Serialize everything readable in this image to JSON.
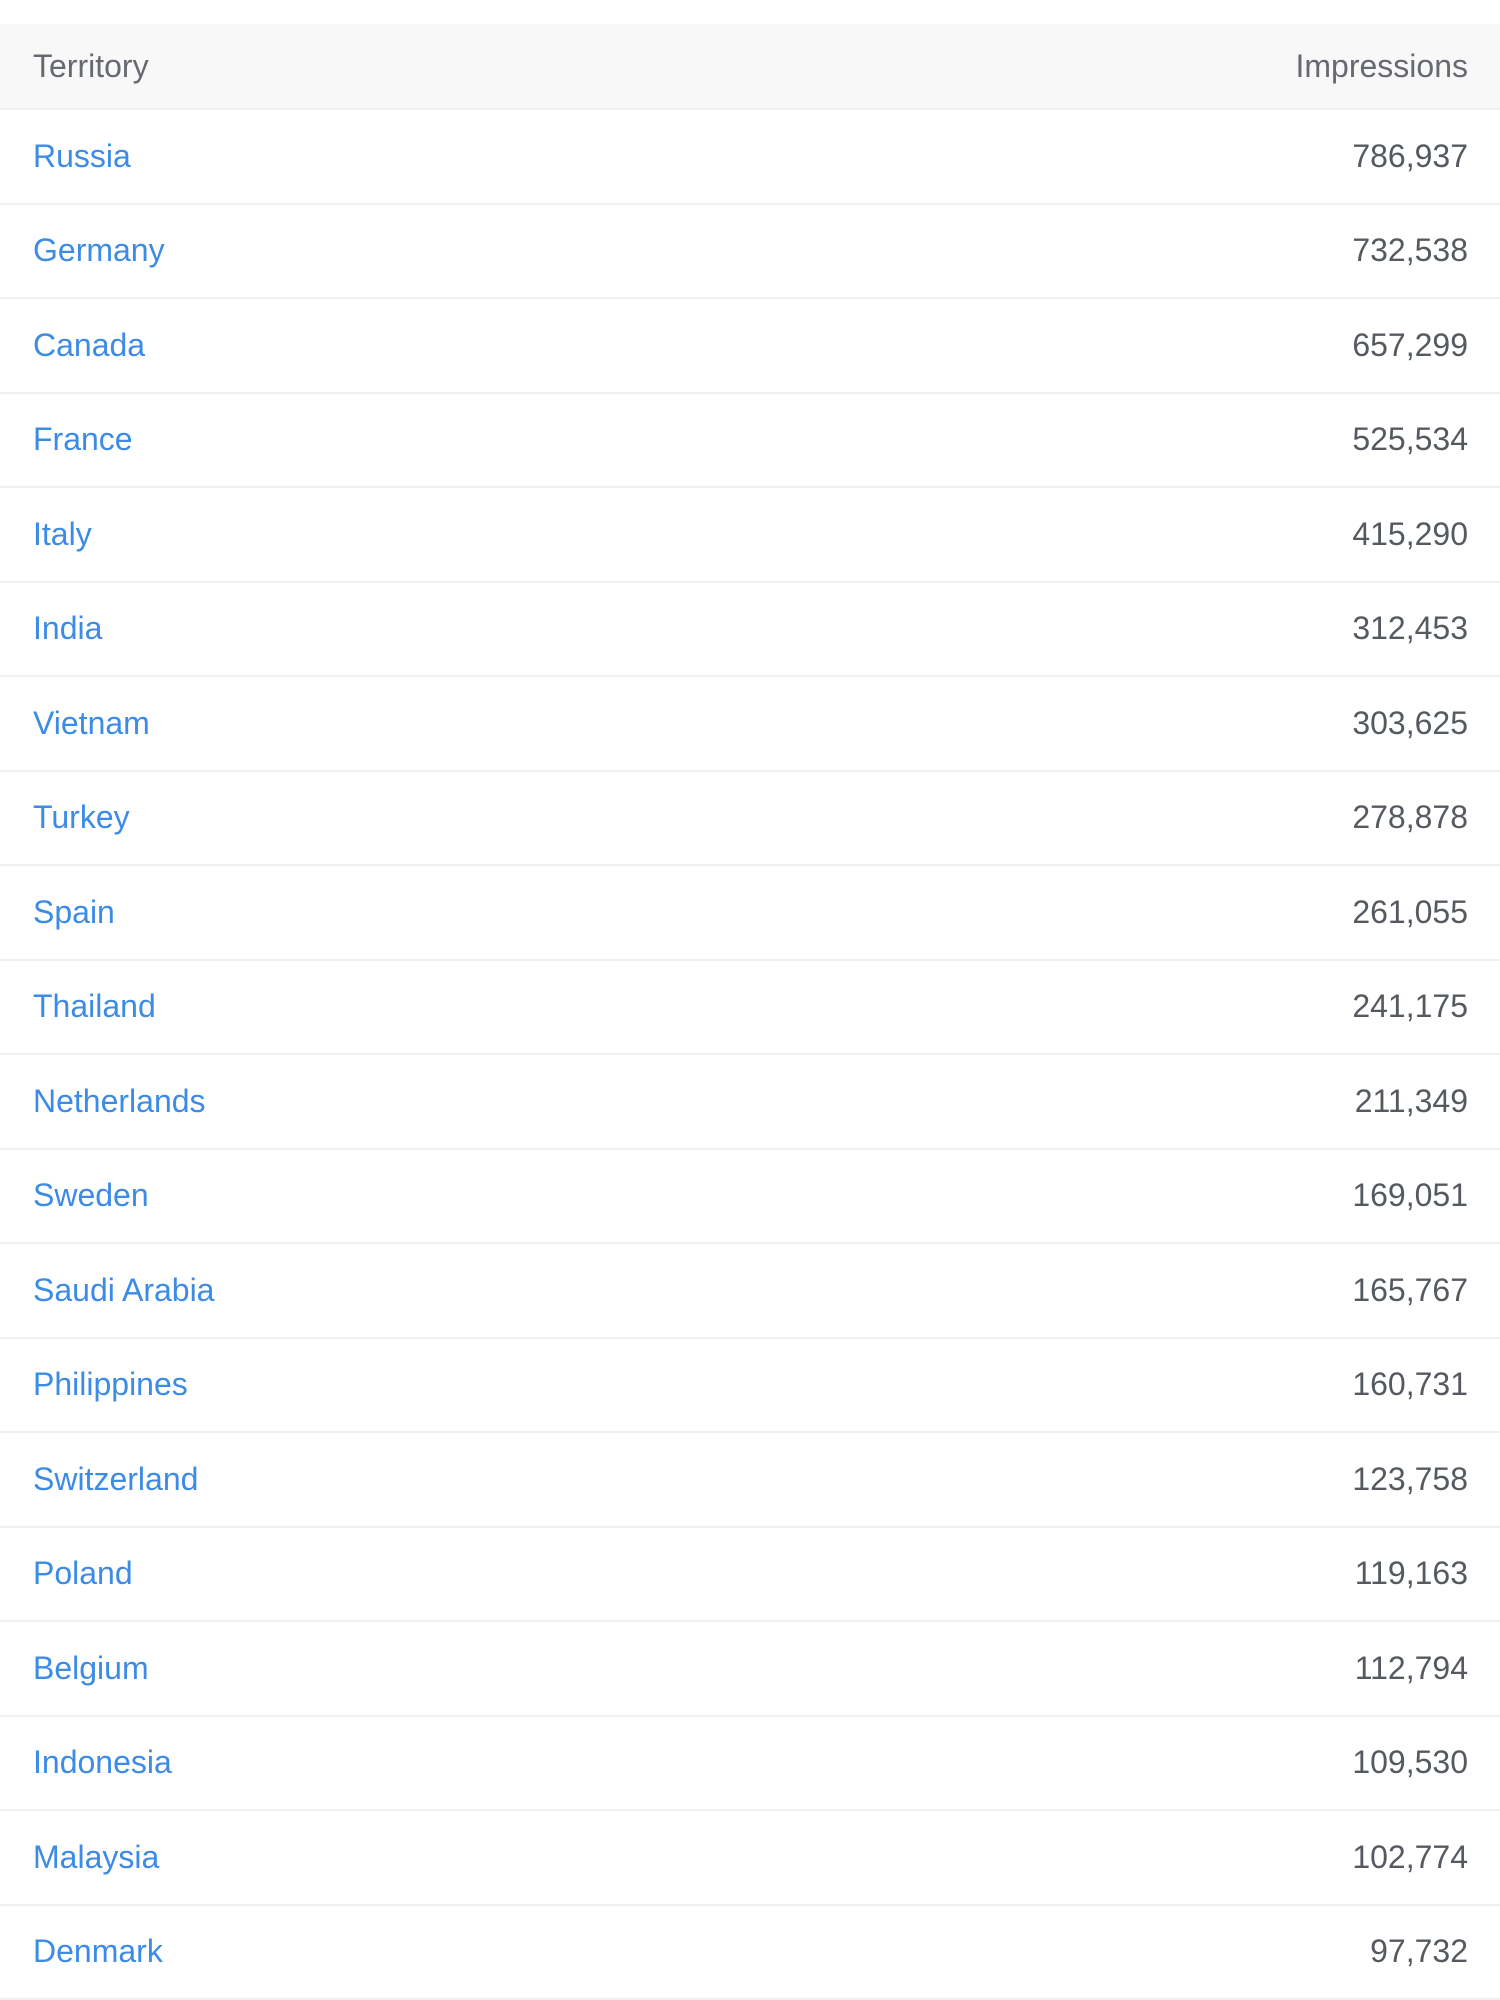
{
  "table": {
    "columns": [
      "Territory",
      "Impressions"
    ],
    "rows": [
      {
        "territory": "Russia",
        "impressions": "786,937"
      },
      {
        "territory": "Germany",
        "impressions": "732,538"
      },
      {
        "territory": "Canada",
        "impressions": "657,299"
      },
      {
        "territory": "France",
        "impressions": "525,534"
      },
      {
        "territory": "Italy",
        "impressions": "415,290"
      },
      {
        "territory": "India",
        "impressions": "312,453"
      },
      {
        "territory": "Vietnam",
        "impressions": "303,625"
      },
      {
        "territory": "Turkey",
        "impressions": "278,878"
      },
      {
        "territory": "Spain",
        "impressions": "261,055"
      },
      {
        "territory": "Thailand",
        "impressions": "241,175"
      },
      {
        "territory": "Netherlands",
        "impressions": "211,349"
      },
      {
        "territory": "Sweden",
        "impressions": "169,051"
      },
      {
        "territory": "Saudi Arabia",
        "impressions": "165,767"
      },
      {
        "territory": "Philippines",
        "impressions": "160,731"
      },
      {
        "territory": "Switzerland",
        "impressions": "123,758"
      },
      {
        "territory": "Poland",
        "impressions": "119,163"
      },
      {
        "territory": "Belgium",
        "impressions": "112,794"
      },
      {
        "territory": "Indonesia",
        "impressions": "109,530"
      },
      {
        "territory": "Malaysia",
        "impressions": "102,774"
      },
      {
        "territory": "Denmark",
        "impressions": "97,732"
      }
    ]
  },
  "colors": {
    "link": "#3c8be6",
    "header_bg": "#f8f8f9",
    "header_text": "#666a70",
    "value_text": "#555a60"
  }
}
